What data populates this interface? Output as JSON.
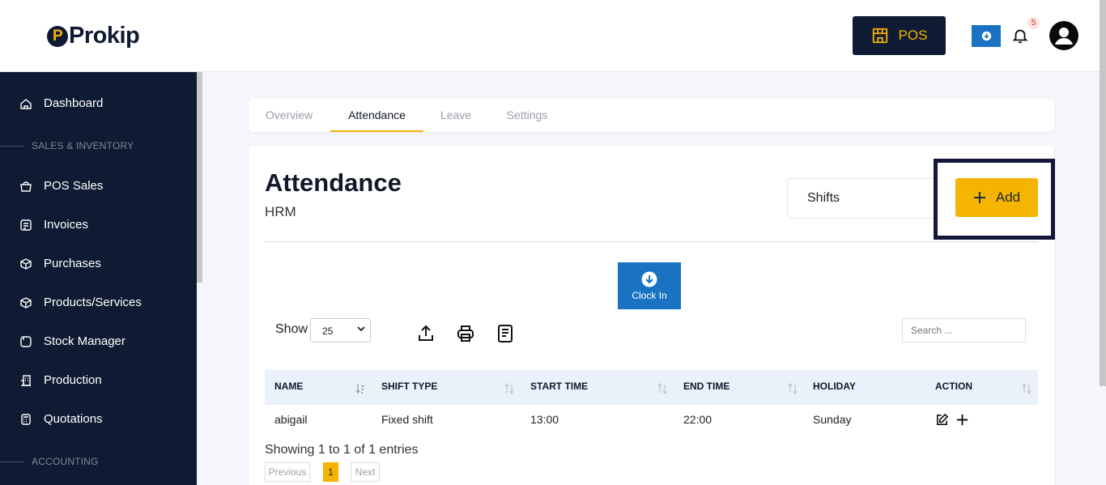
{
  "header": {
    "brand": "Prokip",
    "pos_label": "POS",
    "notification_count": "5"
  },
  "sidebar": {
    "items": [
      {
        "label": "Dashboard",
        "icon": "home-icon"
      },
      {
        "label": "POS Sales",
        "icon": "basket-icon"
      },
      {
        "label": "Invoices",
        "icon": "invoice-icon"
      },
      {
        "label": "Purchases",
        "icon": "box-icon"
      },
      {
        "label": "Products/Services",
        "icon": "cube-icon"
      },
      {
        "label": "Stock Manager",
        "icon": "folder-icon"
      },
      {
        "label": "Production",
        "icon": "building-icon"
      },
      {
        "label": "Quotations",
        "icon": "calculator-icon"
      }
    ],
    "sections": [
      "SALES & INVENTORY",
      "ACCOUNTING"
    ]
  },
  "tabs": [
    "Overview",
    "Attendance",
    "Leave",
    "Settings"
  ],
  "active_tab": "Attendance",
  "page": {
    "title": "Attendance",
    "subtitle": "HRM",
    "dropdown_value": "Shifts",
    "add_label": "Add",
    "clock_in_label": "Clock In"
  },
  "table_controls": {
    "show_label": "Show",
    "page_size": "25",
    "search_placeholder": "Search ..."
  },
  "table": {
    "columns": [
      "NAME",
      "SHIFT TYPE",
      "START TIME",
      "END TIME",
      "HOLIDAY",
      "ACTION"
    ],
    "rows": [
      {
        "name": "abigail",
        "shift_type": "Fixed shift",
        "start_time": "13:00",
        "end_time": "22:00",
        "holiday": "Sunday"
      }
    ]
  },
  "pagination": {
    "summary": "Showing 1 to 1 of 1 entries",
    "previous": "Previous",
    "current": "1",
    "next": "Next"
  },
  "colors": {
    "accent": "#f5b400",
    "sidebar": "#0f1b33",
    "primary_blue": "#1a73c2"
  }
}
